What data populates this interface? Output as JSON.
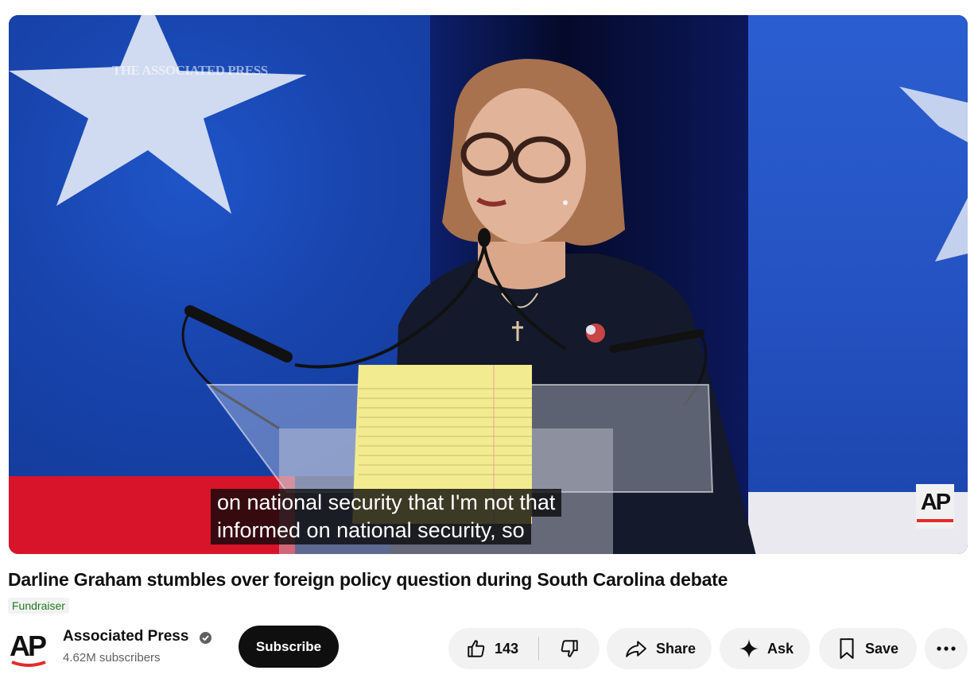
{
  "video": {
    "watermark": "THE ASSOCIATED PRESS",
    "caption_line1": "on national security that I'm not that",
    "caption_line2": "informed on national security, so",
    "logo_bug": "AP"
  },
  "title": "Darline Graham stumbles over foreign policy question during South Carolina debate",
  "tag": "Fundraiser",
  "channel": {
    "logo_text": "AP",
    "name": "Associated Press",
    "verified_icon": "verified-check-icon",
    "subscribers": "4.62M subscribers"
  },
  "actions": {
    "subscribe": "Subscribe",
    "like_count": "143",
    "share": "Share",
    "ask": "Ask",
    "save": "Save"
  },
  "icons": [
    "thumbs-up-icon",
    "thumbs-down-icon",
    "share-arrow-icon",
    "sparkle-icon",
    "bookmark-icon",
    "more-icon"
  ],
  "colors": {
    "subscribe_bg": "#0f0f0f",
    "pill_bg": "#f2f2f2",
    "tag_text": "#1f7a1f",
    "ap_red": "#e32b2b"
  }
}
